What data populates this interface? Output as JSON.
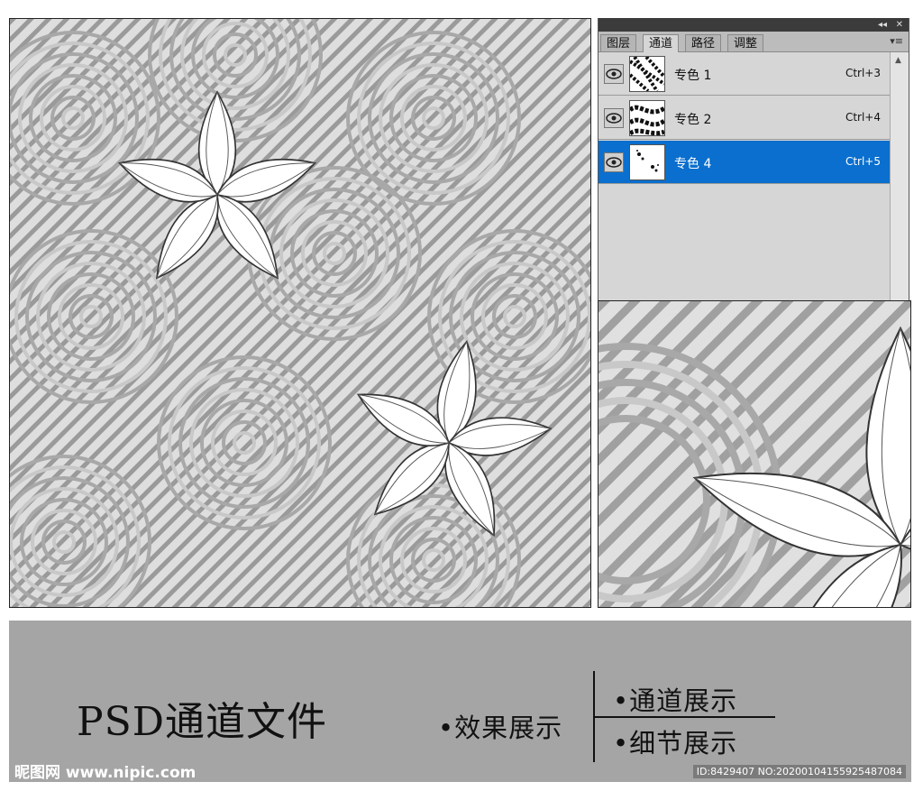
{
  "panel": {
    "tabs": [
      "图层",
      "通道",
      "路径",
      "调整"
    ],
    "active_tab": "通道",
    "channels": [
      {
        "name": "专色 1",
        "shortcut": "Ctrl+3",
        "selected": false
      },
      {
        "name": "专色 2",
        "shortcut": "Ctrl+4",
        "selected": false
      },
      {
        "name": "专色 4",
        "shortcut": "Ctrl+5",
        "selected": true
      }
    ]
  },
  "banner": {
    "title": "PSD通道文件",
    "effect": "•效果展示",
    "channel_show": "•通道展示",
    "detail_show": "•细节展示"
  },
  "watermark": {
    "site": "昵图网 www.nipic.com",
    "id": "ID:8429407 NO:20200104155925487084"
  },
  "colors": {
    "selection": "#0a6fce",
    "banner": "#a5a5a5",
    "pattern_dark": "#8c8c8c",
    "pattern_light": "#d9d9d9"
  }
}
